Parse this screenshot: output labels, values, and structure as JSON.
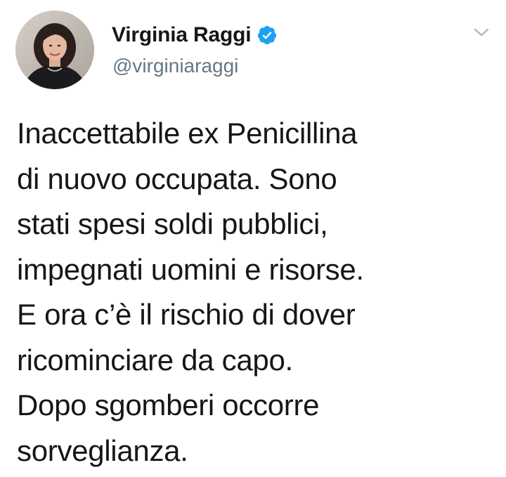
{
  "tweet": {
    "author": {
      "display_name": "Virginia Raggi",
      "handle": "@virginiaraggi",
      "verified": true,
      "avatar_icon": "profile-photo"
    },
    "menu_icon": "chevron-down-icon",
    "text_lines": [
      "Inaccettabile ex Penicillina",
      "di nuovo occupata. Sono",
      "stati spesi soldi pubblici,",
      "impegnati uomini e risorse.",
      "E ora c’è il rischio di dover",
      "ricominciare da capo.",
      "Dopo sgomberi occorre",
      "sorveglianza."
    ]
  },
  "colors": {
    "text": "#14171a",
    "secondary": "#657786",
    "verified_blue": "#1da1f2",
    "caret": "#aab8c2"
  }
}
